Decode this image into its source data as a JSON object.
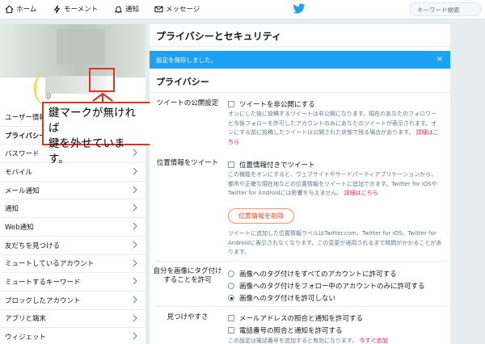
{
  "topbar": {
    "home": "ホーム",
    "moments": "モーメント",
    "notifications": "通知",
    "messages": "メッセージ",
    "search_placeholder": "キーワード検索"
  },
  "profile": {
    "handle": "@"
  },
  "sidebar": {
    "items": [
      {
        "label": "ユーザー情報"
      },
      {
        "label": "プライバシーとセキュリティ"
      },
      {
        "label": "パスワード"
      },
      {
        "label": "モバイル"
      },
      {
        "label": "メール通知"
      },
      {
        "label": "通知"
      },
      {
        "label": "Web通知"
      },
      {
        "label": "友だちを見つける"
      },
      {
        "label": "ミュートしているアカウント"
      },
      {
        "label": "ミュートするキーワード"
      },
      {
        "label": "ブロックしたアカウント"
      },
      {
        "label": "アプリと端末"
      },
      {
        "label": "ウィジェット"
      }
    ]
  },
  "annotation": {
    "line1": "鍵マークが無ければ",
    "line2": "鍵を外せています。"
  },
  "main": {
    "title": "プライバシーとセキュリティ",
    "banner": "設定を保存しました。",
    "banner_close": "×",
    "section": "プライバシー",
    "tweet_privacy": {
      "label": "ツイートの公開設定",
      "option": "ツイートを非公開にする",
      "desc": "オンにした後に投稿するツイートは非公開になります。現在のあなたのフォロワーと今後フォローを許可したアカウントのみにあなたのツイートが表示されます。オンにする前に投稿したツイートは公開された状態で残る場合があります。",
      "link": "詳細はこちら"
    },
    "location": {
      "label": "位置情報をツイート",
      "option": "位置情報付きでツイート",
      "desc": "この機能をオンにすると、ウェブサイトやサードパーティアプリケーションから、都市や正確な現在地などの位置情報をツイートに追加できます。Twitter for iOSやTwitter for Androidには影響を与えません。",
      "link": "詳細はこちら",
      "delete_button": "位置情報を削除",
      "desc2": "ツイートに追加した位置情報ラベルはTwitter.com、Twitter for iOS、Twitter for Androidに表示されなくなります。この変更が適用されるまで時間がかかることがあります。"
    },
    "photo_tag": {
      "label": "自分を画像にタグ付けすることを許可",
      "options": [
        "画像へのタグ付けをすべてのアカウントに許可する",
        "画像へのタグ付けをフォロー中のアカウントのみに許可する",
        "画像へのタグ付けを許可しない"
      ],
      "selected_index": 2
    },
    "discover": {
      "label": "見つけやすさ",
      "options": [
        "メールアドレスの照合と通知を許可する",
        "電話番号の照合と通知を許可する"
      ],
      "desc": "この設定は電話番号を追加すると有効になります。",
      "link": "今すぐ追加"
    }
  },
  "colors": {
    "accent": "#1da1f2",
    "annotation_red": "#e0341e",
    "link": "#e0245e"
  }
}
